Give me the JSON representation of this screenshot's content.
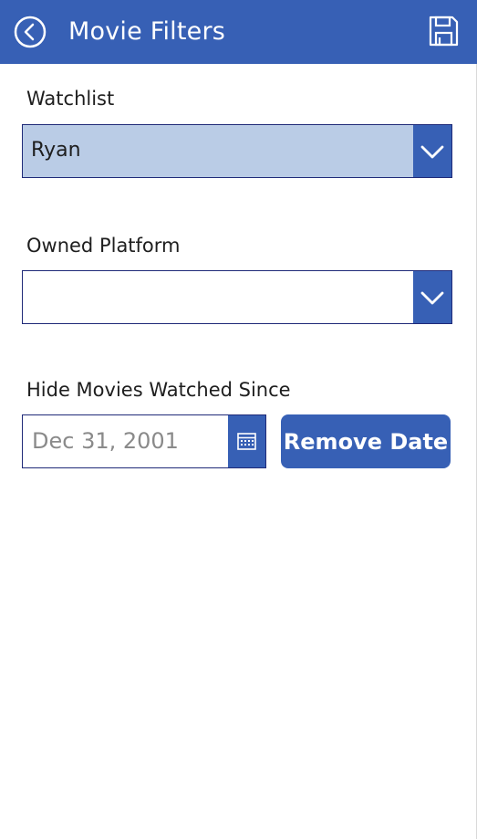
{
  "header": {
    "title": "Movie Filters",
    "back_icon": "back-arrow-circle-icon",
    "save_icon": "floppy-disk-save-icon"
  },
  "watchlist": {
    "label": "Watchlist",
    "selected": "Ryan"
  },
  "platform": {
    "label": "Owned Platform",
    "selected": ""
  },
  "watched_since": {
    "label": "Hide Movies Watched Since",
    "placeholder": "Dec 31, 2001",
    "remove_label": "Remove Date",
    "calendar_icon": "calendar-icon"
  },
  "colors": {
    "accent": "#3760b5",
    "selected_fill": "#bacce6",
    "border": "#1f2a78"
  }
}
